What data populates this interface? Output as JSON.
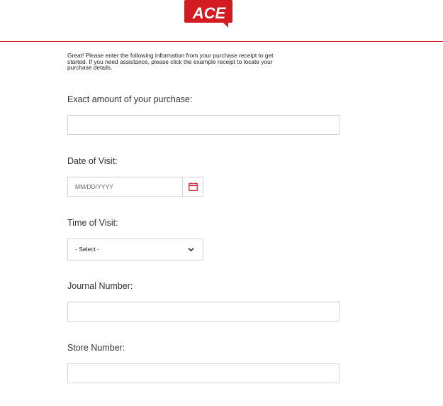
{
  "brand": {
    "logo_text": "ACE",
    "accent_color": "#d21c22"
  },
  "intro": {
    "text": "Great!  Please enter the following information from your purchase receipt to get started. If you need assistance, please click the example receipt to locate your purchase details."
  },
  "fields": {
    "amount": {
      "label": "Exact amount of your purchase:",
      "value": ""
    },
    "date": {
      "label": "Date of Visit:",
      "placeholder": "MM/DD/YYYY",
      "icon": "calendar-icon"
    },
    "time": {
      "label": "Time of Visit:",
      "selected": "- Select -",
      "icon": "chevron-down-icon"
    },
    "journal": {
      "label": "Journal Number:",
      "value": ""
    },
    "store": {
      "label": "Store Number:",
      "value": ""
    }
  }
}
